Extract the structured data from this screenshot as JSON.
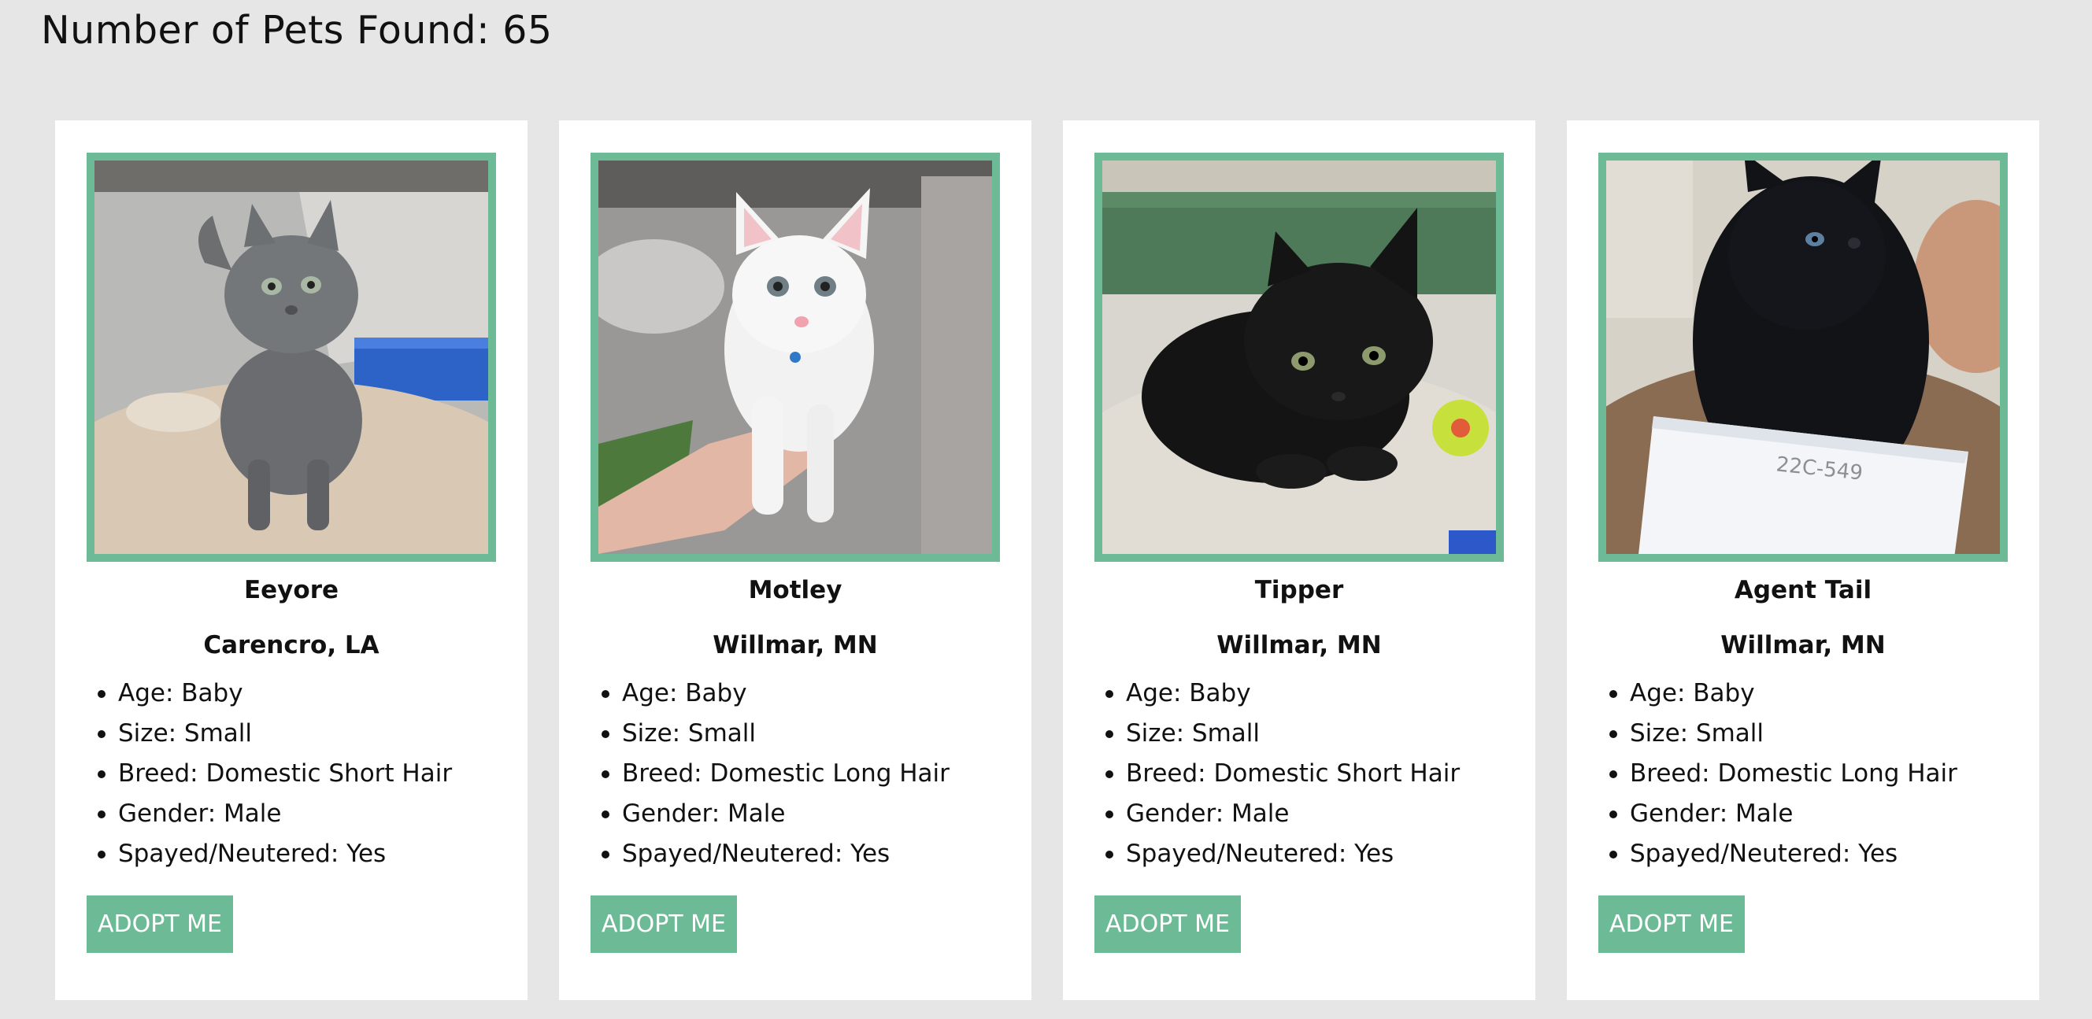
{
  "header": {
    "count_label": "Number of Pets Found: 65"
  },
  "colors": {
    "accent": "#6dbb96",
    "page_background": "#e6e6e6",
    "card_background": "#ffffff"
  },
  "pets": [
    {
      "name": "Eeyore",
      "location": "Carencro, LA",
      "photo_icon": "gray-kitten-photo",
      "attributes": [
        "Age: Baby",
        "Size: Small",
        "Breed: Domestic Short Hair",
        "Gender: Male",
        "Spayed/Neutered: Yes"
      ],
      "button_label": "ADOPT ME"
    },
    {
      "name": "Motley",
      "location": "Willmar, MN",
      "photo_icon": "white-kitten-photo",
      "attributes": [
        "Age: Baby",
        "Size: Small",
        "Breed: Domestic Long Hair",
        "Gender: Male",
        "Spayed/Neutered: Yes"
      ],
      "button_label": "ADOPT ME"
    },
    {
      "name": "Tipper",
      "location": "Willmar, MN",
      "photo_icon": "black-kitten-photo",
      "attributes": [
        "Age: Baby",
        "Size: Small",
        "Breed: Domestic Short Hair",
        "Gender: Male",
        "Spayed/Neutered: Yes"
      ],
      "button_label": "ADOPT ME"
    },
    {
      "name": "Agent Tail",
      "location": "Willmar, MN",
      "photo_icon": "black-longhair-kitten-photo",
      "photo_card_text": "22C-549",
      "attributes": [
        "Age: Baby",
        "Size: Small",
        "Breed: Domestic Long Hair",
        "Gender: Male",
        "Spayed/Neutered: Yes"
      ],
      "button_label": "ADOPT ME"
    }
  ]
}
